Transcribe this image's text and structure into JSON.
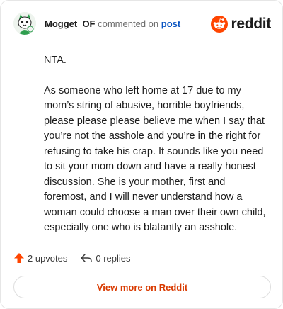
{
  "comment": {
    "username": "Mogget_OF",
    "commented_text": "commented on",
    "post_link": "post",
    "paragraphs": [
      "NTA.",
      "As someone who left home at 17 due to my mom’s string of abusive, horrible boyfriends, please please please believe me when I say that you’re not the asshole and you’re in the right for refusing to take his crap. It sounds like you need to sit your mom down and have a really honest discussion. She is your mother, first and foremost, and I will never understand how a woman could choose a man over their own child, especially one who is blatantly an asshole."
    ],
    "upvotes": "2 upvotes",
    "replies": "0 replies"
  },
  "brand": {
    "logo_text": "reddit",
    "accent": "#ff4500",
    "cta_color": "#d93a00"
  },
  "footer": {
    "cta_label": "View more on Reddit"
  },
  "icons": [
    "avatar-cat",
    "reddit-snoo",
    "upvote-arrow",
    "reply-arrow"
  ]
}
